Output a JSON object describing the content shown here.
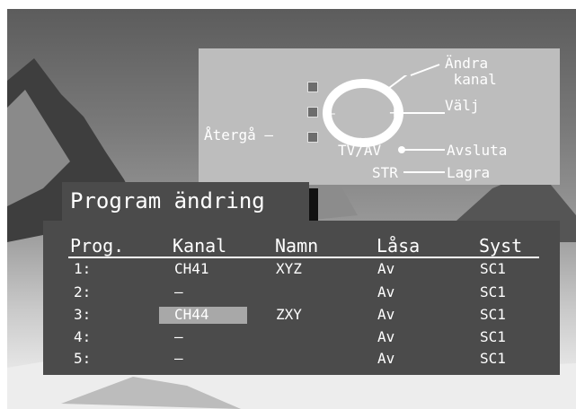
{
  "remote_legend": {
    "change_channel": "Ändra\n kanal",
    "select": "Välj",
    "back": "Återgå –",
    "tv_av": "TV/AV",
    "exit": "Avsluta",
    "str": "STR",
    "save": "Lagra",
    "dpad_up": "∧",
    "dpad_down": "∨",
    "dpad_left": "–",
    "dpad_right": "+"
  },
  "menu": {
    "title": "Program ändring",
    "columns": [
      "Prog.",
      "Kanal",
      "Namn",
      "Låsa",
      "Syst"
    ],
    "rows": [
      {
        "prog": "1:",
        "channel": "CH41",
        "name": "XYZ",
        "lock": "Av",
        "system": "SC1"
      },
      {
        "prog": "2:",
        "channel": "–",
        "name": "",
        "lock": "Av",
        "system": "SC1"
      },
      {
        "prog": "3:",
        "channel": "CH44",
        "name": "ZXY",
        "lock": "Av",
        "system": "SC1"
      },
      {
        "prog": "4:",
        "channel": "–",
        "name": "",
        "lock": "Av",
        "system": "SC1"
      },
      {
        "prog": "5:",
        "channel": "–",
        "name": "",
        "lock": "Av",
        "system": "SC1"
      }
    ],
    "selected_row": 3
  }
}
